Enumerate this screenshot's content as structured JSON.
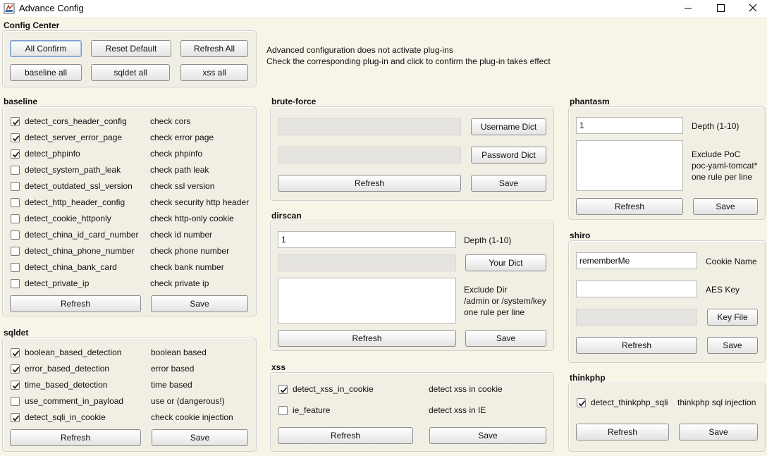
{
  "window": {
    "title": "Advance Config",
    "minimize_glyph": "—",
    "maximize_glyph": "☐",
    "close_glyph": "✕"
  },
  "config_center": {
    "title": "Config Center",
    "all_confirm": "All Confirm",
    "reset_default": "Reset Default",
    "refresh_all": "Refresh All",
    "baseline_all": "baseline all",
    "sqldet_all": "sqldet all",
    "xss_all": "xss all",
    "info_line1": "Advanced configuration does not activate plug-ins",
    "info_line2": "Check the corresponding plug-in and click to confirm the plug-in takes effect"
  },
  "baseline": {
    "title": "baseline",
    "items": [
      {
        "name": "detect_cors_header_config",
        "desc": "check cors",
        "checked": true
      },
      {
        "name": "detect_server_error_page",
        "desc": "check error page",
        "checked": true
      },
      {
        "name": "detect_phpinfo",
        "desc": "check phpinfo",
        "checked": true
      },
      {
        "name": "detect_system_path_leak",
        "desc": "check path leak",
        "checked": false
      },
      {
        "name": "detect_outdated_ssl_version",
        "desc": "check ssl version",
        "checked": false
      },
      {
        "name": "detect_http_header_config",
        "desc": "check security http header",
        "checked": false
      },
      {
        "name": "detect_cookie_httponly",
        "desc": "check http-only cookie",
        "checked": false
      },
      {
        "name": "detect_china_id_card_number",
        "desc": "check id number",
        "checked": false
      },
      {
        "name": "detect_china_phone_number",
        "desc": "check phone number",
        "checked": false
      },
      {
        "name": "detect_china_bank_card",
        "desc": "check bank number",
        "checked": false
      },
      {
        "name": "detect_private_ip",
        "desc": "check private ip",
        "checked": false
      }
    ],
    "refresh": "Refresh",
    "save": "Save"
  },
  "sqldet": {
    "title": "sqldet",
    "items": [
      {
        "name": "boolean_based_detection",
        "desc": "boolean based",
        "checked": true
      },
      {
        "name": "error_based_detection",
        "desc": "error based",
        "checked": true
      },
      {
        "name": "time_based_detection",
        "desc": "time based",
        "checked": true
      },
      {
        "name": "use_comment_in_payload",
        "desc": "use or (dangerous!)",
        "checked": false
      },
      {
        "name": "detect_sqli_in_cookie",
        "desc": "check cookie injection",
        "checked": true
      }
    ],
    "refresh": "Refresh",
    "save": "Save"
  },
  "brute_force": {
    "title": "brute-force",
    "username_value": "",
    "password_value": "",
    "username_dict": "Username Dict",
    "password_dict": "Password Dict",
    "refresh": "Refresh",
    "save": "Save"
  },
  "dirscan": {
    "title": "dirscan",
    "depth_value": "1",
    "depth_label": "Depth (1-10)",
    "dict_value": "",
    "your_dict": "Your Dict",
    "exclude_value": "",
    "exclude_line1": "Exclude Dir",
    "exclude_line2": "/admin or /system/key",
    "exclude_line3": "one rule per line",
    "refresh": "Refresh",
    "save": "Save"
  },
  "xss": {
    "title": "xss",
    "items": [
      {
        "name": "detect_xss_in_cookie",
        "desc": "detect xss in cookie",
        "checked": true
      },
      {
        "name": "ie_feature",
        "desc": "detect xss in IE",
        "checked": false
      }
    ],
    "refresh": "Refresh",
    "save": "Save"
  },
  "phantasm": {
    "title": "phantasm",
    "depth_value": "1",
    "depth_label": "Depth (1-10)",
    "exclude_value": "",
    "exclude_line1": "Exclude PoC",
    "exclude_line2": "poc-yaml-tomcat*",
    "exclude_line3": "one rule per line",
    "refresh": "Refresh",
    "save": "Save"
  },
  "shiro": {
    "title": "shiro",
    "cookie_value": "rememberMe",
    "cookie_label": "Cookie Name",
    "aes_value": "",
    "aes_label": "AES Key",
    "keyfile_value": "",
    "key_file": "Key File",
    "refresh": "Refresh",
    "save": "Save"
  },
  "thinkphp": {
    "title": "thinkphp",
    "items": [
      {
        "name": "detect_thinkphp_sqli",
        "desc": "thinkphp sql injection",
        "checked": true
      }
    ],
    "refresh": "Refresh",
    "save": "Save"
  }
}
